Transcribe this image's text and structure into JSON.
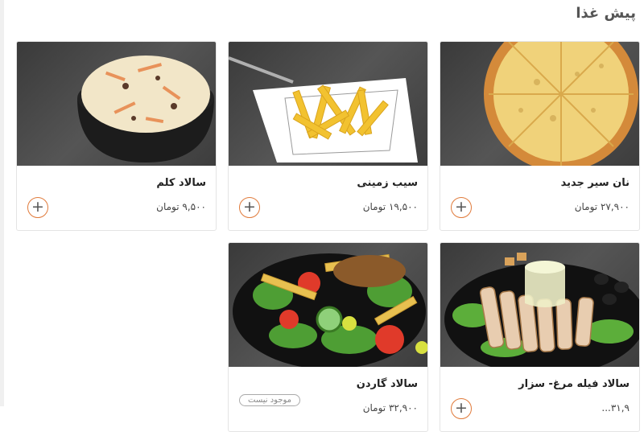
{
  "section": {
    "title": "پیش غذا"
  },
  "products": [
    {
      "name": "نان سیر جدید",
      "price": "۲۷,۹۰۰",
      "currency": "تومان",
      "add_label": "+",
      "image": "garlic-bread-pizza"
    },
    {
      "name": "سیب زمینی",
      "price": "۱۹,۵۰۰",
      "currency": "تومان",
      "add_label": "+",
      "image": "french-fries"
    },
    {
      "name": "سالاد کلم",
      "price": "۹,۵۰۰",
      "currency": "تومان",
      "add_label": "+",
      "image": "coleslaw"
    },
    {
      "name": "سالاد فیله مرغ- سزار",
      "price": "۳۱,۹...",
      "currency": "",
      "add_label": "+",
      "image": "chicken-caesar-salad"
    },
    {
      "name": "سالاد گاردن",
      "price": "۳۲,۹۰۰",
      "currency": "تومان",
      "status": "موجود نیست",
      "image": "garden-salad"
    }
  ],
  "colors": {
    "accent": "#e07a3a",
    "text": "#222222",
    "border": "#e4e4e4"
  }
}
